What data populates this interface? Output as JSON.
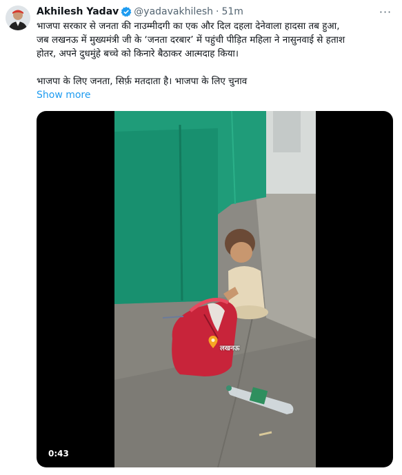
{
  "tweet": {
    "author_name": "Akhilesh Yadav",
    "handle": "@yadavakhilesh",
    "separator": "·",
    "time": "51m",
    "more_icon": "···",
    "text_lines": [
      "भाजपा सरकार से जनता की नाउम्मीदगी का एक और दिल दहला देनेवाला हादसा तब हुआ,",
      "जब लखनऊ में मुख्यमंत्री जी के ‘जनता दरबार’ में पहुंची पीड़ित महिला ने नासुनवाई से हताश",
      "होतर, अपने दुधमुंहे बच्चे को किनारे बैठाकर आत्मदाह किया।",
      "भाजपा के लिए जनता, सिर्फ़ मतदाता है। भाजपा के लिए चुनाव"
    ],
    "show_more": "Show more",
    "verified_color": "#1d9bf0"
  },
  "media": {
    "video_timer": "0:43",
    "location_label": "लखनऊ"
  }
}
